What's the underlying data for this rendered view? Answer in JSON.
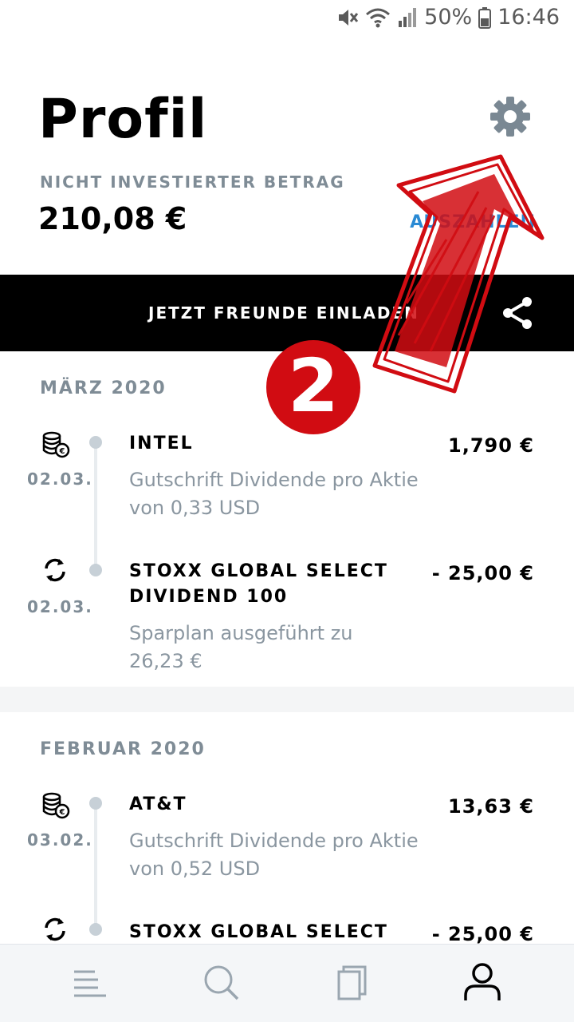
{
  "status_bar": {
    "battery": "50%",
    "time": "16:46"
  },
  "header": {
    "title": "Profil"
  },
  "balance": {
    "label": "NICHT INVESTIERTER BETRAG",
    "amount": "210,08 €",
    "action": "AUSZAHLEN"
  },
  "invite": {
    "label": "JETZT FREUNDE EINLADEN"
  },
  "annotation": {
    "step_number": "2"
  },
  "sections": [
    {
      "month": "MÄRZ 2020",
      "items": [
        {
          "icon": "dividend-coins-icon",
          "date": "02.03.",
          "name": "INTEL",
          "amount": "1,790 €",
          "desc": "Gutschrift Dividende pro Aktie von 0,33 USD"
        },
        {
          "icon": "savings-plan-refresh-icon",
          "date": "02.03.",
          "name": "STOXX GLOBAL SELECT DIVIDEND 100",
          "amount": "- 25,00 €",
          "desc": "Sparplan ausgeführt zu 26,23 €"
        }
      ]
    },
    {
      "month": "FEBRUAR 2020",
      "items": [
        {
          "icon": "dividend-coins-icon",
          "date": "03.02.",
          "name": "AT&T",
          "amount": "13,63 €",
          "desc": "Gutschrift Dividende pro Aktie von 0,52 USD"
        },
        {
          "icon": "savings-plan-refresh-icon",
          "date": "",
          "name": "STOXX GLOBAL SELECT",
          "amount": "- 25,00 €",
          "desc": ""
        }
      ]
    }
  ],
  "nav": [
    {
      "icon": "home-feed-icon",
      "active": false
    },
    {
      "icon": "search-icon",
      "active": false
    },
    {
      "icon": "portfolio-cards-icon",
      "active": false
    },
    {
      "icon": "profile-icon",
      "active": true
    }
  ],
  "colors": {
    "accent_link": "#2a8ad4",
    "muted": "#7f8c96",
    "annotation_red": "#d10c12"
  }
}
